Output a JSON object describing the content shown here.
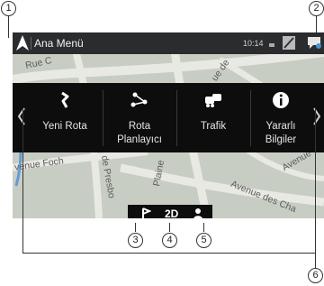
{
  "callouts": {
    "c1": "1",
    "c2": "2",
    "c3": "3",
    "c4": "4",
    "c5": "5",
    "c6": "6"
  },
  "topbar": {
    "title": "Ana Menü",
    "time": "10:14"
  },
  "menu": {
    "items": [
      {
        "label": "Yeni Rota",
        "icon": "new-route-icon"
      },
      {
        "label": "Rota\nPlanlayıcı",
        "icon": "route-planner-icon"
      },
      {
        "label": "Trafik",
        "icon": "traffic-icon"
      },
      {
        "label": "Yararlı\nBilgiler",
        "icon": "info-icon"
      }
    ],
    "left_arrow_icon": "chevron-left-icon",
    "right_arrow_icon": "chevron-right-icon"
  },
  "map": {
    "roads": {
      "rue_c": "Rue C",
      "ue_de": "ue de",
      "avenue_foch": "venue Foch",
      "de_presbo": "de Presbo",
      "plaine": "Plaine",
      "avenue": "Avenue",
      "avenue_des_cha": "Avenue des Cha"
    }
  },
  "toolbar": {
    "mode": "2D",
    "left_icon": "flag-route-icon",
    "right_icon": "person-icon"
  },
  "colors": {
    "panel": "#0d0d0d",
    "topbar": "#2a2c2d",
    "map": "#c8cdc4",
    "roads": "#e8e8e2",
    "accent_blue": "#4a8fd6"
  }
}
